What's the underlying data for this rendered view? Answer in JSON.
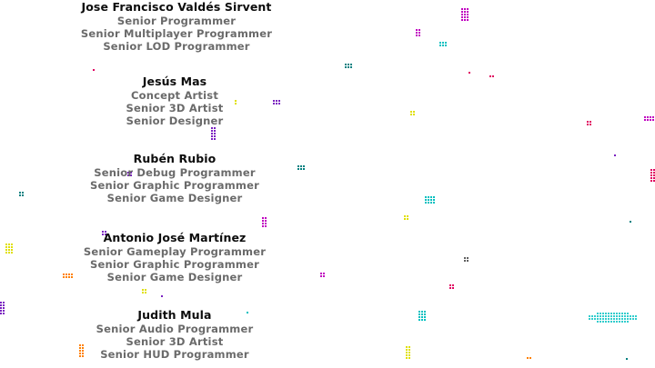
{
  "credits": [
    {
      "name": "Jose Francisco Valdés Sirvent",
      "roles": [
        "Senior Programmer",
        "Senior Multiplayer Programmer",
        "Senior LOD Programmer"
      ]
    },
    {
      "name": "Jesús Mas",
      "roles": [
        "Concept Artist",
        "Senior 3D Artist",
        "Senior Designer"
      ]
    },
    {
      "name": "Rubén Rubio",
      "roles": [
        "Senior Debug Programmer",
        "Senior Graphic Programmer",
        "Senior Game Designer"
      ]
    },
    {
      "name": "Antonio José Martínez",
      "roles": [
        "Senior Gameplay Programmer",
        "Senior Graphic Programmer",
        "Senior Game Designer"
      ]
    },
    {
      "name": "Judith Mula",
      "roles": [
        "Senior Audio Programmer",
        "Senior 3D Artist",
        "Senior HUD Programmer"
      ]
    }
  ],
  "colors": {
    "background": "#ffffff",
    "name_text": "#0c0c0c",
    "role_text": "#6a6a6a",
    "particle_palette": [
      "#c000c0",
      "#00c0c0",
      "#e0e000",
      "#e00060",
      "#7a20c0",
      "#ff8000",
      "#008080",
      "#606060"
    ]
  }
}
